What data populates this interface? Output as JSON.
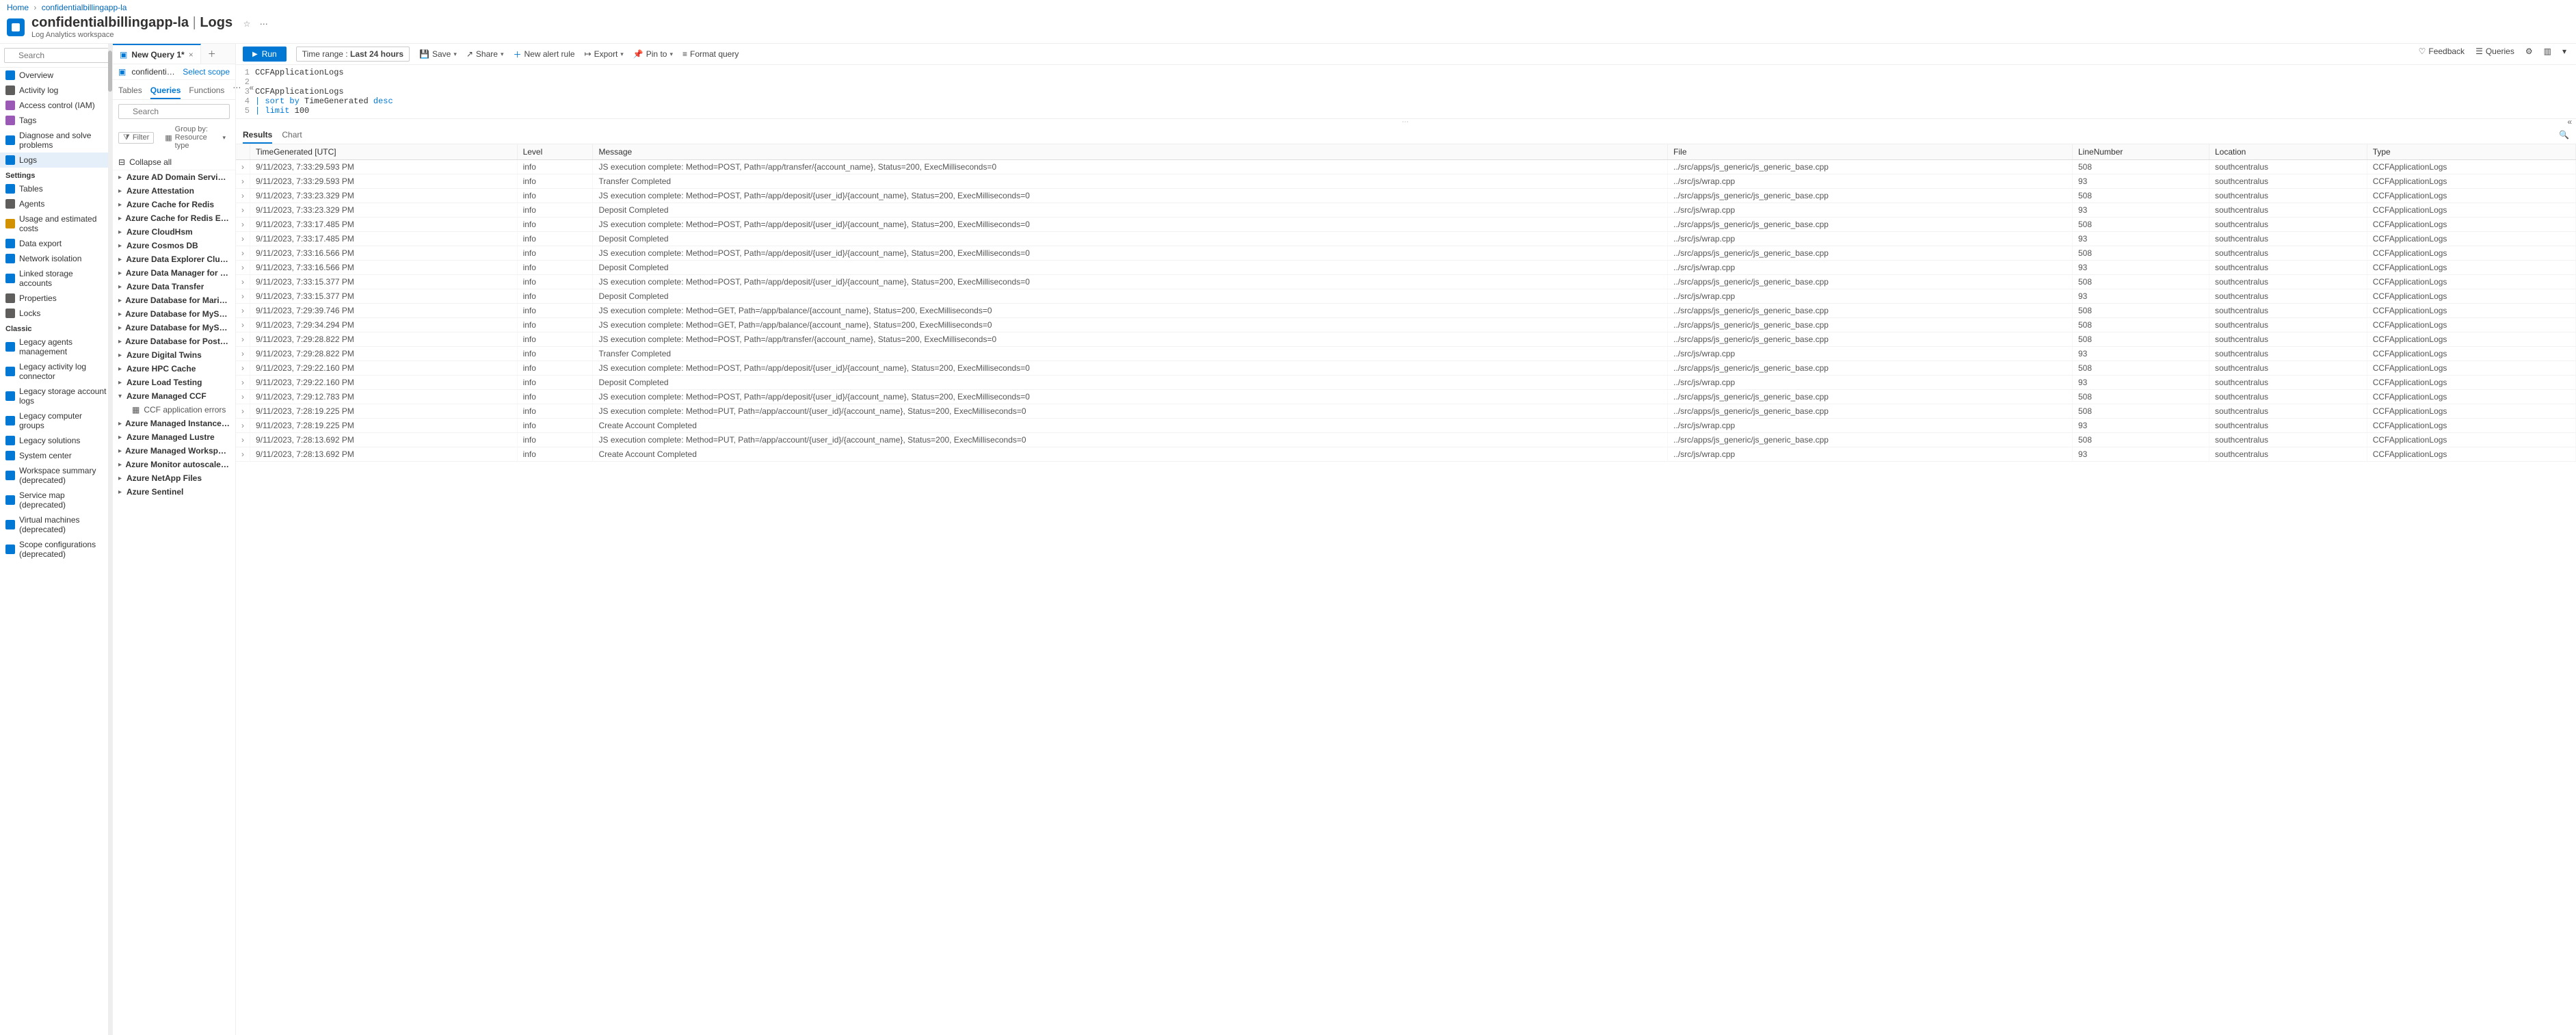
{
  "breadcrumbs": [
    "Home",
    "confidentialbillingapp-la"
  ],
  "header": {
    "title": "confidentialbillingapp-la",
    "section": "Logs",
    "subtitle": "Log Analytics workspace"
  },
  "left_search_placeholder": "Search",
  "nav": {
    "top": [
      {
        "icon": "overview",
        "label": "Overview"
      },
      {
        "icon": "activity",
        "label": "Activity log"
      },
      {
        "icon": "people",
        "label": "Access control (IAM)"
      },
      {
        "icon": "tag",
        "label": "Tags"
      },
      {
        "icon": "diagnose",
        "label": "Diagnose and solve problems"
      },
      {
        "icon": "logs",
        "label": "Logs",
        "active": true
      }
    ],
    "sections": [
      {
        "title": "Settings",
        "items": [
          {
            "icon": "table",
            "label": "Tables"
          },
          {
            "icon": "agents",
            "label": "Agents"
          },
          {
            "icon": "cost",
            "label": "Usage and estimated costs"
          },
          {
            "icon": "export",
            "label": "Data export"
          },
          {
            "icon": "net",
            "label": "Network isolation"
          },
          {
            "icon": "link",
            "label": "Linked storage accounts"
          },
          {
            "icon": "props",
            "label": "Properties"
          },
          {
            "icon": "lock",
            "label": "Locks"
          }
        ]
      },
      {
        "title": "Classic",
        "items": [
          {
            "icon": "legacy",
            "label": "Legacy agents management"
          },
          {
            "icon": "legacy",
            "label": "Legacy activity log connector"
          },
          {
            "icon": "legacy",
            "label": "Legacy storage account logs"
          },
          {
            "icon": "legacy",
            "label": "Legacy computer groups"
          },
          {
            "icon": "legacy",
            "label": "Legacy solutions"
          },
          {
            "icon": "legacy",
            "label": "System center"
          },
          {
            "icon": "legacy",
            "label": "Workspace summary (deprecated)"
          },
          {
            "icon": "legacy",
            "label": "Service map (deprecated)"
          },
          {
            "icon": "legacy",
            "label": "Virtual machines (deprecated)"
          },
          {
            "icon": "legacy",
            "label": "Scope configurations (deprecated)"
          }
        ]
      }
    ]
  },
  "topActions": {
    "feedback": "Feedback",
    "queries": "Queries"
  },
  "queryTab": {
    "label": "New Query 1*"
  },
  "scope": {
    "name": "confidentialbilling…",
    "select": "Select scope"
  },
  "panelTabs": {
    "tables": "Tables",
    "queries": "Queries",
    "functions": "Functions"
  },
  "panelSearchPlaceholder": "Search",
  "filter": "Filter",
  "groupBy": "Group by: Resource type",
  "collapseAll": "Collapse all",
  "tree": [
    {
      "label": "Azure AD Domain Services"
    },
    {
      "label": "Azure Attestation"
    },
    {
      "label": "Azure Cache for Redis"
    },
    {
      "label": "Azure Cache for Redis Enterprise"
    },
    {
      "label": "Azure CloudHsm"
    },
    {
      "label": "Azure Cosmos DB"
    },
    {
      "label": "Azure Data Explorer Clusters"
    },
    {
      "label": "Azure Data Manager for Energy"
    },
    {
      "label": "Azure Data Transfer"
    },
    {
      "label": "Azure Database for MariaDB Serve"
    },
    {
      "label": "Azure Database for MySQL Flexible"
    },
    {
      "label": "Azure Database for MySQL Servers"
    },
    {
      "label": "Azure Database for PostgreSQL Se"
    },
    {
      "label": "Azure Digital Twins"
    },
    {
      "label": "Azure HPC Cache"
    },
    {
      "label": "Azure Load Testing"
    },
    {
      "label": "Azure Managed CCF",
      "expanded": true,
      "children": [
        {
          "label": "CCF application errors"
        }
      ]
    },
    {
      "label": "Azure Managed Instance for Apach"
    },
    {
      "label": "Azure Managed Lustre"
    },
    {
      "label": "Azure Managed Workspace for Gra"
    },
    {
      "label": "Azure Monitor autoscale settings"
    },
    {
      "label": "Azure NetApp Files"
    },
    {
      "label": "Azure Sentinel"
    }
  ],
  "toolbar": {
    "run": "Run",
    "timeRangeLabel": "Time range :",
    "timeRangeValue": "Last 24 hours",
    "save": "Save",
    "share": "Share",
    "newAlert": "New alert rule",
    "export": "Export",
    "pin": "Pin to",
    "format": "Format query"
  },
  "editorLines": [
    {
      "n": "1",
      "text": "CCFApplicationLogs"
    },
    {
      "n": "2",
      "text": ""
    },
    {
      "n": "3",
      "text": "CCFApplicationLogs"
    },
    {
      "n": "4",
      "text": "| sort by TimeGenerated desc"
    },
    {
      "n": "5",
      "text": "| limit 100"
    }
  ],
  "resultsTabs": {
    "results": "Results",
    "chart": "Chart"
  },
  "columns": [
    "",
    "TimeGenerated [UTC]",
    "Level",
    "Message",
    "File",
    "LineNumber",
    "Location",
    "Type"
  ],
  "rows": [
    {
      "time": "9/11/2023, 7:33:29.593 PM",
      "lvl": "info",
      "msg": "JS execution complete: Method=POST, Path=/app/transfer/{account_name}, Status=200, ExecMilliseconds=0",
      "file": "../src/apps/js_generic/js_generic_base.cpp",
      "ln": "508",
      "loc": "southcentralus",
      "type": "CCFApplicationLogs"
    },
    {
      "time": "9/11/2023, 7:33:29.593 PM",
      "lvl": "info",
      "msg": "Transfer Completed",
      "file": "../src/js/wrap.cpp",
      "ln": "93",
      "loc": "southcentralus",
      "type": "CCFApplicationLogs"
    },
    {
      "time": "9/11/2023, 7:33:23.329 PM",
      "lvl": "info",
      "msg": "JS execution complete: Method=POST, Path=/app/deposit/{user_id}/{account_name}, Status=200, ExecMilliseconds=0",
      "file": "../src/apps/js_generic/js_generic_base.cpp",
      "ln": "508",
      "loc": "southcentralus",
      "type": "CCFApplicationLogs"
    },
    {
      "time": "9/11/2023, 7:33:23.329 PM",
      "lvl": "info",
      "msg": "Deposit Completed",
      "file": "../src/js/wrap.cpp",
      "ln": "93",
      "loc": "southcentralus",
      "type": "CCFApplicationLogs"
    },
    {
      "time": "9/11/2023, 7:33:17.485 PM",
      "lvl": "info",
      "msg": "JS execution complete: Method=POST, Path=/app/deposit/{user_id}/{account_name}, Status=200, ExecMilliseconds=0",
      "file": "../src/apps/js_generic/js_generic_base.cpp",
      "ln": "508",
      "loc": "southcentralus",
      "type": "CCFApplicationLogs"
    },
    {
      "time": "9/11/2023, 7:33:17.485 PM",
      "lvl": "info",
      "msg": "Deposit Completed",
      "file": "../src/js/wrap.cpp",
      "ln": "93",
      "loc": "southcentralus",
      "type": "CCFApplicationLogs"
    },
    {
      "time": "9/11/2023, 7:33:16.566 PM",
      "lvl": "info",
      "msg": "JS execution complete: Method=POST, Path=/app/deposit/{user_id}/{account_name}, Status=200, ExecMilliseconds=0",
      "file": "../src/apps/js_generic/js_generic_base.cpp",
      "ln": "508",
      "loc": "southcentralus",
      "type": "CCFApplicationLogs"
    },
    {
      "time": "9/11/2023, 7:33:16.566 PM",
      "lvl": "info",
      "msg": "Deposit Completed",
      "file": "../src/js/wrap.cpp",
      "ln": "93",
      "loc": "southcentralus",
      "type": "CCFApplicationLogs"
    },
    {
      "time": "9/11/2023, 7:33:15.377 PM",
      "lvl": "info",
      "msg": "JS execution complete: Method=POST, Path=/app/deposit/{user_id}/{account_name}, Status=200, ExecMilliseconds=0",
      "file": "../src/apps/js_generic/js_generic_base.cpp",
      "ln": "508",
      "loc": "southcentralus",
      "type": "CCFApplicationLogs"
    },
    {
      "time": "9/11/2023, 7:33:15.377 PM",
      "lvl": "info",
      "msg": "Deposit Completed",
      "file": "../src/js/wrap.cpp",
      "ln": "93",
      "loc": "southcentralus",
      "type": "CCFApplicationLogs"
    },
    {
      "time": "9/11/2023, 7:29:39.746 PM",
      "lvl": "info",
      "msg": "JS execution complete: Method=GET, Path=/app/balance/{account_name}, Status=200, ExecMilliseconds=0",
      "file": "../src/apps/js_generic/js_generic_base.cpp",
      "ln": "508",
      "loc": "southcentralus",
      "type": "CCFApplicationLogs"
    },
    {
      "time": "9/11/2023, 7:29:34.294 PM",
      "lvl": "info",
      "msg": "JS execution complete: Method=GET, Path=/app/balance/{account_name}, Status=200, ExecMilliseconds=0",
      "file": "../src/apps/js_generic/js_generic_base.cpp",
      "ln": "508",
      "loc": "southcentralus",
      "type": "CCFApplicationLogs"
    },
    {
      "time": "9/11/2023, 7:29:28.822 PM",
      "lvl": "info",
      "msg": "JS execution complete: Method=POST, Path=/app/transfer/{account_name}, Status=200, ExecMilliseconds=0",
      "file": "../src/apps/js_generic/js_generic_base.cpp",
      "ln": "508",
      "loc": "southcentralus",
      "type": "CCFApplicationLogs"
    },
    {
      "time": "9/11/2023, 7:29:28.822 PM",
      "lvl": "info",
      "msg": "Transfer Completed",
      "file": "../src/js/wrap.cpp",
      "ln": "93",
      "loc": "southcentralus",
      "type": "CCFApplicationLogs"
    },
    {
      "time": "9/11/2023, 7:29:22.160 PM",
      "lvl": "info",
      "msg": "JS execution complete: Method=POST, Path=/app/deposit/{user_id}/{account_name}, Status=200, ExecMilliseconds=0",
      "file": "../src/apps/js_generic/js_generic_base.cpp",
      "ln": "508",
      "loc": "southcentralus",
      "type": "CCFApplicationLogs"
    },
    {
      "time": "9/11/2023, 7:29:22.160 PM",
      "lvl": "info",
      "msg": "Deposit Completed",
      "file": "../src/js/wrap.cpp",
      "ln": "93",
      "loc": "southcentralus",
      "type": "CCFApplicationLogs"
    },
    {
      "time": "9/11/2023, 7:29:12.783 PM",
      "lvl": "info",
      "msg": "JS execution complete: Method=POST, Path=/app/deposit/{user_id}/{account_name}, Status=200, ExecMilliseconds=0",
      "file": "../src/apps/js_generic/js_generic_base.cpp",
      "ln": "508",
      "loc": "southcentralus",
      "type": "CCFApplicationLogs"
    },
    {
      "time": "9/11/2023, 7:28:19.225 PM",
      "lvl": "info",
      "msg": "JS execution complete: Method=PUT, Path=/app/account/{user_id}/{account_name}, Status=200, ExecMilliseconds=0",
      "file": "../src/apps/js_generic/js_generic_base.cpp",
      "ln": "508",
      "loc": "southcentralus",
      "type": "CCFApplicationLogs"
    },
    {
      "time": "9/11/2023, 7:28:19.225 PM",
      "lvl": "info",
      "msg": "Create Account Completed",
      "file": "../src/js/wrap.cpp",
      "ln": "93",
      "loc": "southcentralus",
      "type": "CCFApplicationLogs"
    },
    {
      "time": "9/11/2023, 7:28:13.692 PM",
      "lvl": "info",
      "msg": "JS execution complete: Method=PUT, Path=/app/account/{user_id}/{account_name}, Status=200, ExecMilliseconds=0",
      "file": "../src/apps/js_generic/js_generic_base.cpp",
      "ln": "508",
      "loc": "southcentralus",
      "type": "CCFApplicationLogs"
    },
    {
      "time": "9/11/2023, 7:28:13.692 PM",
      "lvl": "info",
      "msg": "Create Account Completed",
      "file": "../src/js/wrap.cpp",
      "ln": "93",
      "loc": "southcentralus",
      "type": "CCFApplicationLogs"
    }
  ]
}
